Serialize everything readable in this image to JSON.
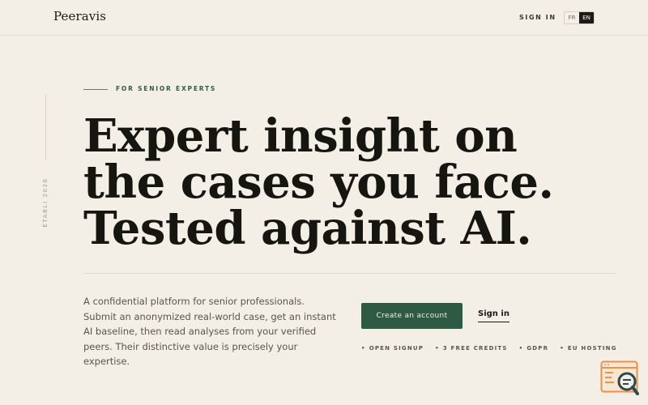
{
  "header": {
    "brand": "Peeravis",
    "sign_in": "SIGN IN",
    "languages": {
      "fr": "FR",
      "en": "EN",
      "active": "EN"
    }
  },
  "side": {
    "label": "ÉTABLI 2026"
  },
  "hero": {
    "eyebrow": "FOR SENIOR EXPERTS",
    "headline": [
      "Expert insight on",
      "the cases you face.",
      "Tested against AI."
    ],
    "description": "A confidential platform for senior professionals. Submit an anonymized real-world case, get an instant AI baseline, then read analyses from your verified peers. Their distinctive value is precisely your expertise.",
    "cta_label": "Create an account",
    "signin_label": "Sign in",
    "features": [
      "OPEN SIGNUP",
      "3 FREE CREDITS",
      "GDPR",
      "EU HOSTING"
    ]
  },
  "colors": {
    "background": "#f3efe6",
    "accent": "#2e5a43",
    "text": "#1c1a16",
    "widget": "#e8924a"
  },
  "icons": {
    "widget": "search-document-icon"
  }
}
